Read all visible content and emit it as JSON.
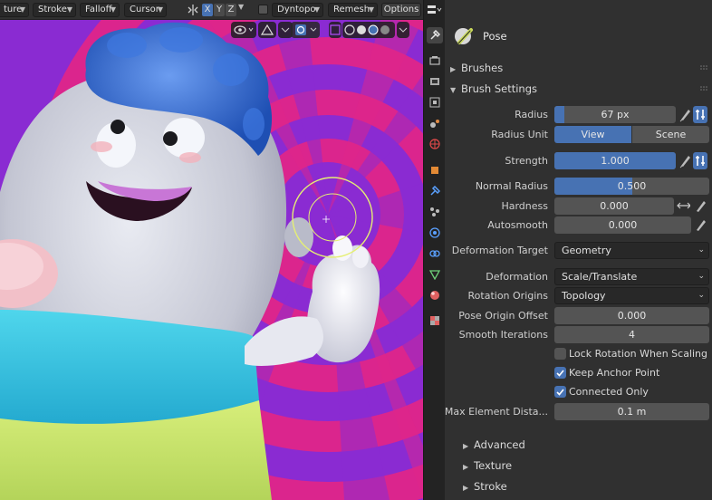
{
  "header": {
    "menus": [
      "ture",
      "Stroke",
      "Falloff",
      "Cursor"
    ],
    "axes": [
      "X",
      "Y",
      "Z"
    ],
    "dyntopo_label": "Dyntopo",
    "remesh_label": "Remesh",
    "options_label": "Options"
  },
  "tabs": [
    "tool-icon",
    "render-icon",
    "output-icon",
    "view-layer-icon",
    "scene-icon",
    "world-icon",
    "object-icon",
    "modifier-icon",
    "particles-icon",
    "physics-icon",
    "constraints-icon",
    "object-data-icon",
    "material-icon",
    "texture-icon"
  ],
  "panel": {
    "brush_name": "Pose",
    "sections": {
      "brushes": "Brushes",
      "brush_settings": "Brush Settings",
      "advanced": "Advanced",
      "texture": "Texture",
      "stroke": "Stroke"
    },
    "radius": {
      "label": "Radius",
      "value": "67 px",
      "fill": 0.08
    },
    "radius_unit": {
      "label": "Radius Unit",
      "options": [
        "View",
        "Scene"
      ],
      "selected": "View"
    },
    "strength": {
      "label": "Strength",
      "value": "1.000",
      "fill": 1.0
    },
    "normal_radius": {
      "label": "Normal Radius",
      "value": "0.500",
      "fill": 0.5
    },
    "hardness": {
      "label": "Hardness",
      "value": "0.000"
    },
    "autosmooth": {
      "label": "Autosmooth",
      "value": "0.000"
    },
    "deformation_target": {
      "label": "Deformation Target",
      "value": "Geometry"
    },
    "deformation": {
      "label": "Deformation",
      "value": "Scale/Translate"
    },
    "rotation_origins": {
      "label": "Rotation Origins",
      "value": "Topology"
    },
    "pose_origin_offset": {
      "label": "Pose Origin Offset",
      "value": "0.000"
    },
    "smooth_iterations": {
      "label": "Smooth Iterations",
      "value": "4"
    },
    "lock_rotation": {
      "label": "Lock Rotation When Scaling",
      "checked": false
    },
    "keep_anchor": {
      "label": "Keep Anchor Point",
      "checked": true
    },
    "connected_only": {
      "label": "Connected Only",
      "checked": true
    },
    "max_element_distance": {
      "label": "Max Element Dista...",
      "value": "0.1 m"
    }
  },
  "colors": {
    "accent": "#4772b3",
    "background_magenta": "#e0258a",
    "background_purple": "#8a2bd2"
  }
}
